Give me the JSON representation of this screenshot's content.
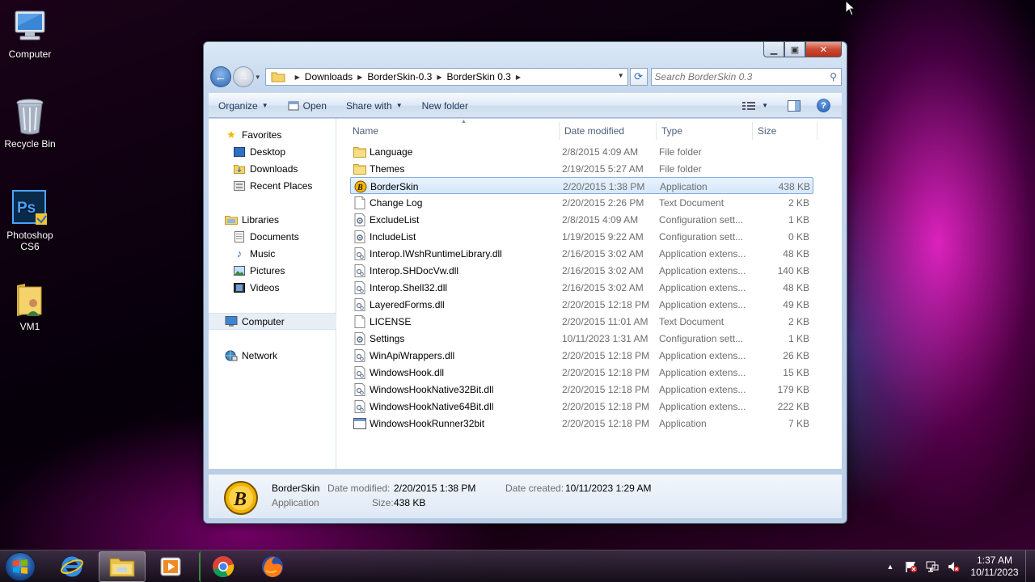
{
  "desktop": {
    "icons": [
      {
        "label": "Computer"
      },
      {
        "label": "Recycle Bin"
      },
      {
        "label": "Photoshop CS6"
      },
      {
        "label": "VM1"
      }
    ]
  },
  "explorer": {
    "address": {
      "crumbs": [
        "Downloads",
        "BorderSkin-0.3",
        "BorderSkin 0.3"
      ]
    },
    "search_placeholder": "Search BorderSkin 0.3",
    "toolbar": {
      "organize": "Organize",
      "open": "Open",
      "share_with": "Share with",
      "new_folder": "New folder"
    },
    "nav": {
      "favorites": "Favorites",
      "desktop": "Desktop",
      "downloads": "Downloads",
      "recent_places": "Recent Places",
      "libraries": "Libraries",
      "documents": "Documents",
      "music": "Music",
      "pictures": "Pictures",
      "videos": "Videos",
      "computer": "Computer",
      "network": "Network"
    },
    "columns": {
      "name": "Name",
      "date_modified": "Date modified",
      "type": "Type",
      "size": "Size"
    },
    "files": [
      {
        "name": "Language",
        "date": "2/8/2015 4:09 AM",
        "type": "File folder",
        "size": "",
        "icon": "folder"
      },
      {
        "name": "Themes",
        "date": "2/19/2015 5:27 AM",
        "type": "File folder",
        "size": "",
        "icon": "folder"
      },
      {
        "name": "BorderSkin",
        "date": "2/20/2015 1:38 PM",
        "type": "Application",
        "size": "438 KB",
        "icon": "app-b",
        "selected": true
      },
      {
        "name": "Change Log",
        "date": "2/20/2015 2:26 PM",
        "type": "Text Document",
        "size": "2 KB",
        "icon": "text"
      },
      {
        "name": "ExcludeList",
        "date": "2/8/2015 4:09 AM",
        "type": "Configuration sett...",
        "size": "1 KB",
        "icon": "config"
      },
      {
        "name": "IncludeList",
        "date": "1/19/2015 9:22 AM",
        "type": "Configuration sett...",
        "size": "0 KB",
        "icon": "config"
      },
      {
        "name": "Interop.IWshRuntimeLibrary.dll",
        "date": "2/16/2015 3:02 AM",
        "type": "Application extens...",
        "size": "48 KB",
        "icon": "dll"
      },
      {
        "name": "Interop.SHDocVw.dll",
        "date": "2/16/2015 3:02 AM",
        "type": "Application extens...",
        "size": "140 KB",
        "icon": "dll"
      },
      {
        "name": "Interop.Shell32.dll",
        "date": "2/16/2015 3:02 AM",
        "type": "Application extens...",
        "size": "48 KB",
        "icon": "dll"
      },
      {
        "name": "LayeredForms.dll",
        "date": "2/20/2015 12:18 PM",
        "type": "Application extens...",
        "size": "49 KB",
        "icon": "dll"
      },
      {
        "name": "LICENSE",
        "date": "2/20/2015 11:01 AM",
        "type": "Text Document",
        "size": "2 KB",
        "icon": "text"
      },
      {
        "name": "Settings",
        "date": "10/11/2023 1:31 AM",
        "type": "Configuration sett...",
        "size": "1 KB",
        "icon": "config"
      },
      {
        "name": "WinApiWrappers.dll",
        "date": "2/20/2015 12:18 PM",
        "type": "Application extens...",
        "size": "26 KB",
        "icon": "dll"
      },
      {
        "name": "WindowsHook.dll",
        "date": "2/20/2015 12:18 PM",
        "type": "Application extens...",
        "size": "15 KB",
        "icon": "dll"
      },
      {
        "name": "WindowsHookNative32Bit.dll",
        "date": "2/20/2015 12:18 PM",
        "type": "Application extens...",
        "size": "179 KB",
        "icon": "dll"
      },
      {
        "name": "WindowsHookNative64Bit.dll",
        "date": "2/20/2015 12:18 PM",
        "type": "Application extens...",
        "size": "222 KB",
        "icon": "dll"
      },
      {
        "name": "WindowsHookRunner32bit",
        "date": "2/20/2015 12:18 PM",
        "type": "Application",
        "size": "7 KB",
        "icon": "app-window"
      }
    ],
    "details": {
      "name": "BorderSkin",
      "type": "Application",
      "date_modified_label": "Date modified:",
      "date_modified": "2/20/2015 1:38 PM",
      "date_created_label": "Date created:",
      "date_created": "10/11/2023 1:29 AM",
      "size_label": "Size:",
      "size": "438 KB"
    }
  },
  "taskbar": {
    "apps": [
      "internet-explorer-icon",
      "windows-explorer-icon",
      "media-player-icon",
      "chrome-icon",
      "firefox-icon"
    ],
    "clock_time": "1:37 AM",
    "clock_date": "10/11/2023"
  },
  "colors": {
    "accent": "#2b66b4",
    "selection": "#d4e7fb",
    "close_red": "#c94a33"
  }
}
